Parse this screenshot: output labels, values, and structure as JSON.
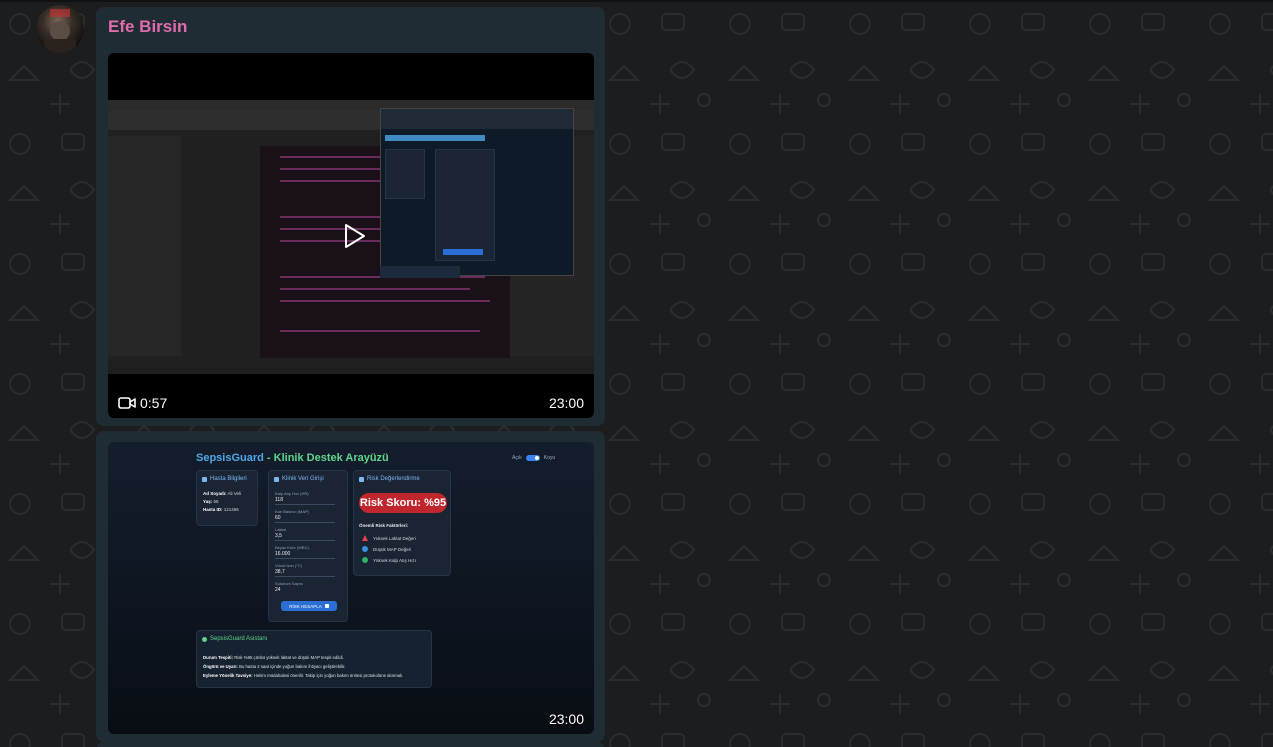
{
  "contact": {
    "name": "Efe Birsin",
    "name_color": "#e06cae"
  },
  "colors": {
    "bubble": "#202c33",
    "background": "#1b1d1f",
    "accent_blue": "#4fa8e8",
    "accent_green": "#5fd48c",
    "risk_red": "#c0262d"
  },
  "messages": [
    {
      "type": "video",
      "duration": "0:57",
      "time": "23:00",
      "icons": {
        "duration": "video-camera-icon",
        "play": "play-icon"
      }
    },
    {
      "type": "image",
      "time": "23:00",
      "screenshot": {
        "app_title_a": "SepsisGuard",
        "app_title_b": "- Klinik Destek Arayüzü",
        "toggle_left": "Açık",
        "toggle_right": "Koyu",
        "patient": {
          "header": "Hasta Bilgileri",
          "name_label": "Ad Soyadı:",
          "name_value": "Ali Veli",
          "age_label": "Yaş:",
          "age_value": "65",
          "id_label": "Hasta ID:",
          "id_value": "121456"
        },
        "clinical": {
          "header": "Klinik Veri Girişi",
          "fields": [
            {
              "label": "Kalp Atış Hızı (HR)",
              "value": "118"
            },
            {
              "label": "Kan Basıncı (MAP)",
              "value": "60"
            },
            {
              "label": "Laktat",
              "value": "3,5"
            },
            {
              "label": "Beyaz Küre (WBC)",
              "value": "16.000"
            },
            {
              "label": "Vücut Isısı (°C)",
              "value": "38,7"
            },
            {
              "label": "Solunum Sayısı",
              "value": "24"
            }
          ],
          "button": "RİSK HESAPLA"
        },
        "risk": {
          "header": "Risk Değerlendirme",
          "score": "Risk Skoru: %95",
          "factors_header": "Önemli Risk Faktörleri:",
          "factors": [
            "Yüksek Laktat Değeri",
            "Düşük MAP Değeri",
            "Yüksek Kalp Atış Hızı"
          ]
        },
        "assistant": {
          "header": "SepsisGuard Asistanı",
          "lines": [
            {
              "label": "Durum Tespiti:",
              "text": "Risk %95 çünkü yüksek laktat ve düşük MAP tespit edildi."
            },
            {
              "label": "Öngörü ve Uyarı:",
              "text": "Bu hasta 2 saat içinde yoğun bakım ihtiyacı geliştirebilir."
            },
            {
              "label": "Eyleme Yönelik Tavsiye:",
              "text": "Hekim müdahalesi önerilir. Takip için yoğun bakım ünitesi protokolüne alınmalı."
            }
          ]
        }
      }
    }
  ]
}
